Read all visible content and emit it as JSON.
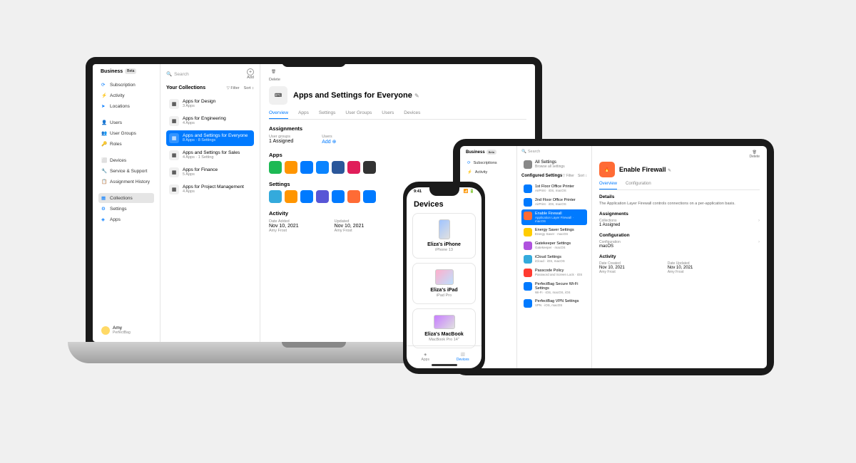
{
  "macbook": {
    "brand": "Business",
    "beta": "Beta",
    "search_placeholder": "Search",
    "add_label": "Add",
    "delete_label": "Delete",
    "sidebar": {
      "items": [
        {
          "label": "Subscription",
          "icon": "refresh-icon"
        },
        {
          "label": "Activity",
          "icon": "activity-icon"
        },
        {
          "label": "Locations",
          "icon": "location-icon"
        }
      ],
      "users_section": [
        {
          "label": "Users",
          "icon": "users-icon"
        },
        {
          "label": "User Groups",
          "icon": "user-groups-icon"
        },
        {
          "label": "Roles",
          "icon": "key-icon"
        }
      ],
      "devices_section": [
        {
          "label": "Devices",
          "icon": "devices-icon"
        },
        {
          "label": "Service & Support",
          "icon": "wrench-icon"
        },
        {
          "label": "Assignment History",
          "icon": "history-icon"
        }
      ],
      "config_section": [
        {
          "label": "Collections",
          "icon": "collections-icon",
          "active": true
        },
        {
          "label": "Settings",
          "icon": "settings-icon"
        },
        {
          "label": "Apps",
          "icon": "apps-icon"
        }
      ]
    },
    "user": {
      "name": "Amy",
      "org": "PerfectBag"
    },
    "collections": {
      "title": "Your Collections",
      "filter": "Filter",
      "sort": "Sort",
      "items": [
        {
          "name": "Apps for Design",
          "meta": "3 Apps"
        },
        {
          "name": "Apps for Engineering",
          "meta": "4 Apps"
        },
        {
          "name": "Apps and Settings for Everyone",
          "meta": "8 Apps · 8 Settings",
          "selected": true
        },
        {
          "name": "Apps and Settings for Sales",
          "meta": "4 Apps · 1 Setting"
        },
        {
          "name": "Apps for Finance",
          "meta": "5 Apps"
        },
        {
          "name": "Apps for Project Management",
          "meta": "4 Apps"
        }
      ]
    },
    "main": {
      "title": "Apps and Settings for Everyone",
      "tabs": [
        "Overview",
        "Apps",
        "Settings",
        "User Groups",
        "Users",
        "Devices"
      ],
      "active_tab": 0,
      "assignments": {
        "title": "Assignments",
        "user_groups_label": "User groups",
        "user_groups_value": "1 Assigned",
        "users_label": "Users",
        "users_add": "Add"
      },
      "apps_title": "Apps",
      "app_colors": [
        "#1db954",
        "#ff9500",
        "#007aff",
        "#0a84ff",
        "#2b579a",
        "#e01e5a",
        "#333333"
      ],
      "settings_title": "Settings",
      "setting_colors": [
        "#34aadc",
        "#ff9500",
        "#007aff",
        "#5856d6",
        "#007aff",
        "#ff6b35",
        "#007aff"
      ],
      "activity": {
        "title": "Activity",
        "added_label": "Date Added",
        "added_value": "Nov 10, 2021",
        "added_user": "Amy Frost",
        "updated_label": "Updated",
        "updated_value": "Nov 10, 2021",
        "updated_user": "Amy Frost"
      }
    }
  },
  "iphone": {
    "time": "9:41",
    "title": "Devices",
    "devices": [
      {
        "name": "Eliza's iPhone",
        "model": "iPhone 13"
      },
      {
        "name": "Eliza's iPad",
        "model": "iPad Pro"
      },
      {
        "name": "Eliza's MacBook",
        "model": "MacBook Pro 14\""
      }
    ],
    "tabs": [
      {
        "label": "Apps"
      },
      {
        "label": "Devices",
        "active": true
      }
    ]
  },
  "ipad": {
    "brand": "Business",
    "beta": "Beta",
    "search_placeholder": "Search",
    "delete_label": "Delete",
    "sidebar": [
      {
        "label": "Subscriptions"
      },
      {
        "label": "Activity"
      }
    ],
    "all_settings": {
      "name": "All Settings",
      "meta": "Browse all settings"
    },
    "configured_title": "Configured Settings",
    "filter": "Filter",
    "sort": "Sort",
    "settings": [
      {
        "name": "1st Floor Office Printer",
        "meta": "AirPrint · iOS, macOS",
        "color": "#007aff"
      },
      {
        "name": "2nd Floor Office Printer",
        "meta": "AirPrint · iOS, macOS",
        "color": "#007aff"
      },
      {
        "name": "Enable Firewall",
        "meta": "Application Layer Firewall · macOS",
        "color": "#ff6b35",
        "selected": true
      },
      {
        "name": "Energy Saver Settings",
        "meta": "Energy Saver · macOS",
        "color": "#ffcc00"
      },
      {
        "name": "Gatekeeper Settings",
        "meta": "Gatekeeper · macOS",
        "color": "#af52de"
      },
      {
        "name": "iCloud Settings",
        "meta": "iCloud · iOS, macOS",
        "color": "#34aadc"
      },
      {
        "name": "Passcode Policy",
        "meta": "Password and Screen Lock · iOS",
        "color": "#ff3b30"
      },
      {
        "name": "PerfectBag Secure Wi-Fi Settings",
        "meta": "Wi-Fi · iOS, macOS, iOS",
        "color": "#007aff"
      },
      {
        "name": "PerfectBag VPN Settings",
        "meta": "VPN · iOS, macOS",
        "color": "#007aff"
      }
    ],
    "main": {
      "title": "Enable Firewall",
      "tabs": [
        "Overview",
        "Configuration"
      ],
      "details_title": "Details",
      "details_text": "The Application Layer Firewall controls connections on a per-application basis.",
      "assignments_title": "Assignments",
      "collections_label": "Collections",
      "collections_value": "1 Assigned",
      "config_title": "Configuration",
      "config_label": "Configuration",
      "config_value": "macOS",
      "activity_title": "Activity",
      "created_label": "Date Created",
      "created_value": "Nov 10, 2021",
      "created_user": "Amy Frost",
      "updated_label": "Date Updated",
      "updated_value": "Nov 10, 2021",
      "updated_user": "Amy Frost"
    }
  }
}
